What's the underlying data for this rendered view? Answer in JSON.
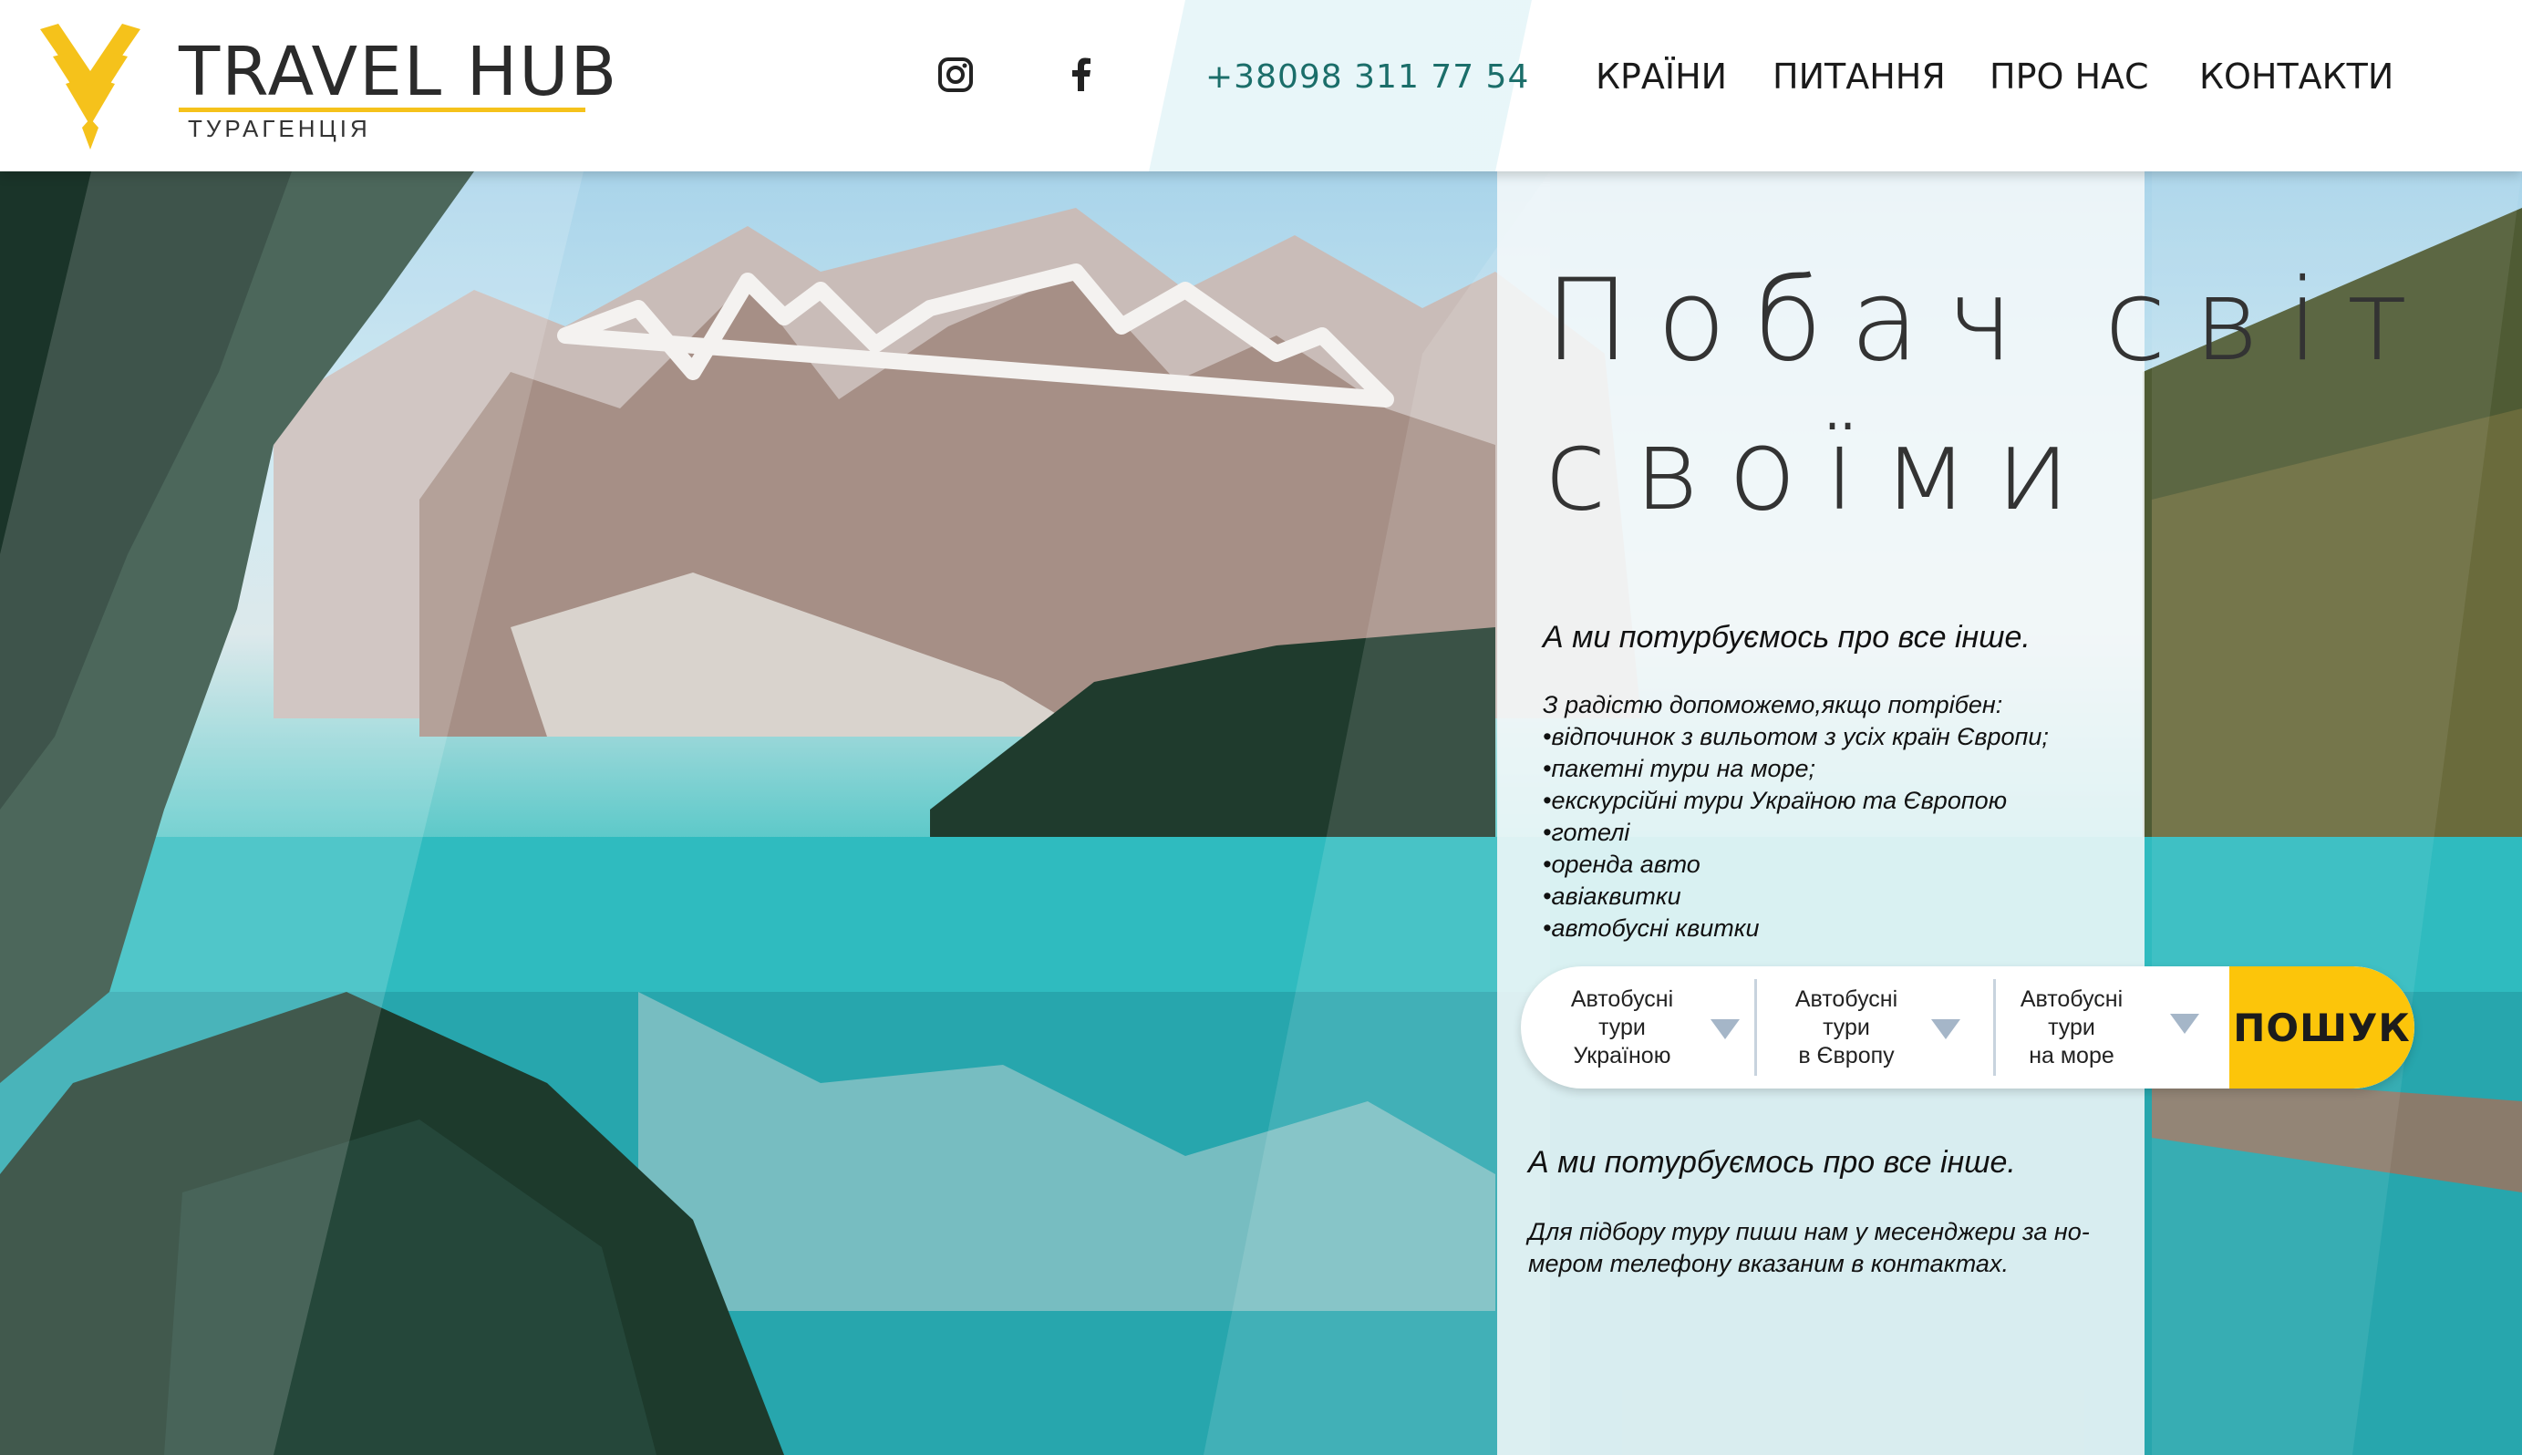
{
  "brand": {
    "name": "TRAVEL HUB",
    "tagline": "ТУРАГЕНЦІЯ",
    "accent_color": "#f5c21b"
  },
  "header": {
    "social": [
      {
        "icon": "instagram-icon"
      },
      {
        "icon": "facebook-icon"
      }
    ],
    "phone": "+38098 311 77 54",
    "nav": [
      "КРАЇНИ",
      "ПИТАННЯ",
      "ПРО НАС",
      "КОНТАКТИ"
    ]
  },
  "hero": {
    "headline_line1": "Побач світ",
    "headline_line2": "своїми",
    "lead": "А ми потурбуємось про все інше.",
    "services_intro": "З радістю допоможемо,якщо потрібен:",
    "services": [
      "відпочинок з вильотом з усіх країн Європи;",
      "пакетні тури на море;",
      "екскурсійні тури Україною та Європою",
      "готелі",
      "оренда авто",
      "авіаквитки",
      "автобусні квитки"
    ]
  },
  "search": {
    "selects": [
      {
        "label": "Автобусні\nтури\nУкраїною"
      },
      {
        "label": "Автобусні\nтури\nв Європу"
      },
      {
        "label": "Автобусні\nтури\nна море"
      }
    ],
    "button_label": "ПОШУК",
    "button_color": "#fcc50a"
  },
  "footer_text": {
    "lead": "А ми потурбуємось про все інше.",
    "note": "Для підбору туру пиши нам у месенджери за но-\nмером телефону вказаним в контактах."
  }
}
